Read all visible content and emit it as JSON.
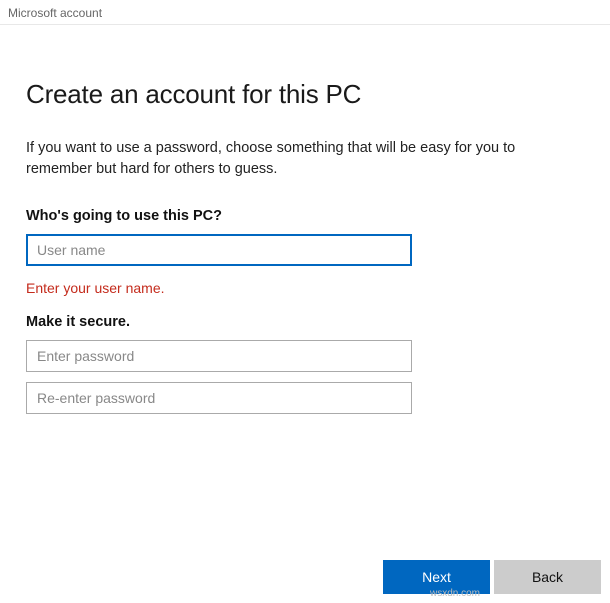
{
  "window": {
    "title": "Microsoft account"
  },
  "page": {
    "heading": "Create an account for this PC",
    "description": "If you want to use a password, choose something that will be easy for you to remember but hard for others to guess."
  },
  "sections": {
    "who": {
      "label": "Who's going to use this PC?",
      "username_placeholder": "User name",
      "username_value": "",
      "error": "Enter your user name."
    },
    "secure": {
      "label": "Make it secure.",
      "password_placeholder": "Enter password",
      "password_value": "",
      "reenter_placeholder": "Re-enter password",
      "reenter_value": ""
    }
  },
  "footer": {
    "next": "Next",
    "back": "Back"
  },
  "watermark": "wsxdn.com"
}
